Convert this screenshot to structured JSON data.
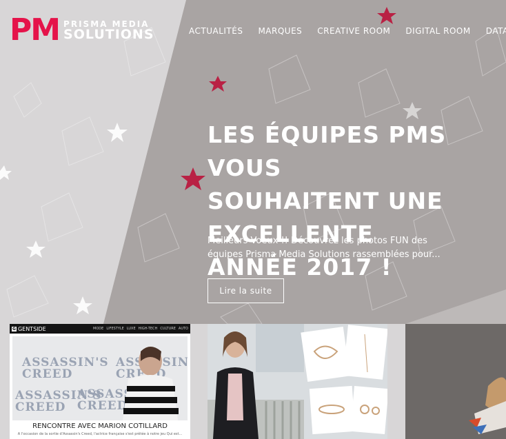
{
  "logo": {
    "mark": "PM",
    "line1": "PRISMA MEDIA",
    "line2": "SOLUTIONS"
  },
  "nav": [
    "ACTUALITÉS",
    "MARQUES",
    "CREATIVE ROOM",
    "DIGITAL ROOM",
    "DATA ROOM"
  ],
  "hero": {
    "title": "LES ÉQUIPES PMS VOUS\nSOUHAITENT UNE EXCELLENTE\nANNÉE 2017 !",
    "description": "Meilleurs Voeux !! Découvrez les photos FUN des équipes Prisma Media Solutions rassemblées pour...",
    "button": "Lire la suite"
  },
  "cards": {
    "c1": {
      "site": "GENTSIDE",
      "site_badge": "G",
      "site_nav": [
        "MODE",
        "LIFESTYLE",
        "LUXE",
        "HIGH-TECH",
        "CULTURE",
        "AUTO"
      ],
      "banner": [
        "ASSASSIN'S",
        "CREED"
      ],
      "caption": "RENCONTRE AVEC MARION COTILLARD",
      "subtext": "A l'occasion de la sortie d'Assassin's Creed, l'actrice française s'est prêtée à notre jeu Qui est..."
    }
  },
  "colors": {
    "brand": "#e5134a",
    "bg_light": "#d6d4d5",
    "bg_dark": "#a9a4a3",
    "flower": "#b92144"
  }
}
